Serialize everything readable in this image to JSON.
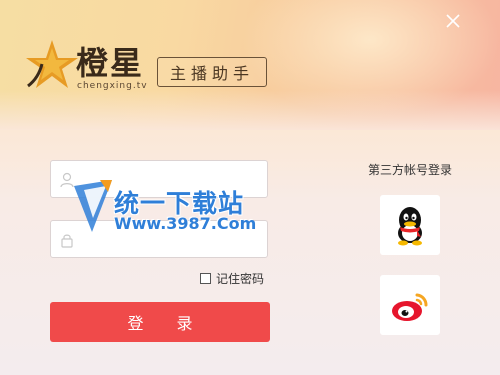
{
  "brand": {
    "title": "橙星",
    "subtitle": "chengxing.tv",
    "app_tag": "主播助手"
  },
  "login": {
    "username_value": "",
    "password_value": "",
    "remember_label": "记住密码",
    "remember_checked": false,
    "login_button": "登 录"
  },
  "third_party": {
    "title": "第三方帐号登录",
    "providers": [
      {
        "name": "qq-icon"
      },
      {
        "name": "weibo-icon"
      }
    ]
  },
  "watermark": {
    "text": "统一下载站",
    "url": "Www.3987.Com"
  },
  "colors": {
    "accent": "#f04a4a",
    "watermark": "#2f7fd8"
  }
}
